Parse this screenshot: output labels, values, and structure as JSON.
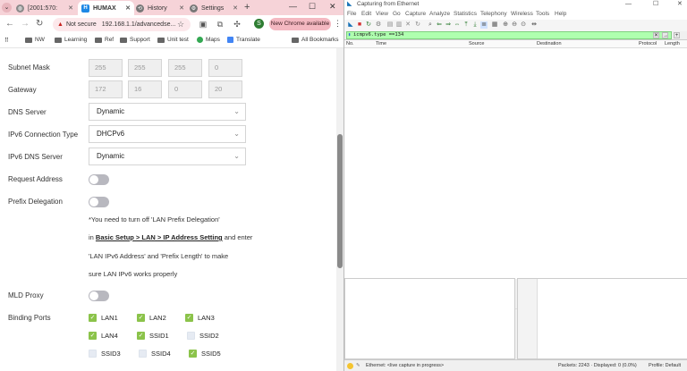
{
  "chrome": {
    "tabs": [
      {
        "label": "[2001:570:",
        "active": false
      },
      {
        "label": "HUMAX",
        "active": true
      },
      {
        "label": "History",
        "active": false
      },
      {
        "label": "Settings",
        "active": false
      }
    ],
    "omnibox": {
      "security": "Not secure",
      "url": "192.168.1.1/advancedse..."
    },
    "profile_initial": "S",
    "new_chrome_label": "New Chrome available",
    "bookmarks": [
      "NW",
      "Learning",
      "Ref",
      "Support",
      "Unit test",
      "Maps",
      "Translate"
    ],
    "all_bookmarks_label": "All Bookmarks"
  },
  "router": {
    "subnet_mask": {
      "label": "Subnet Mask",
      "octets": [
        "255",
        "255",
        "255",
        "0"
      ]
    },
    "gateway": {
      "label": "Gateway",
      "octets": [
        "172",
        "16",
        "0",
        "20"
      ]
    },
    "dns_server": {
      "label": "DNS Server",
      "value": "Dynamic"
    },
    "ipv6_connection_type": {
      "label": "IPv6 Connection Type",
      "value": "DHCPv6"
    },
    "ipv6_dns_server": {
      "label": "IPv6 DNS Server",
      "value": "Dynamic"
    },
    "request_address": {
      "label": "Request Address",
      "enabled": false
    },
    "prefix_delegation": {
      "label": "Prefix Delegation",
      "enabled": false
    },
    "note": {
      "line1": "*You need to turn off 'LAN Prefix Delegation'",
      "line2_prefix": "in ",
      "line2_link": "Basic Setup > LAN > IP Address Setting",
      "line2_suffix": " and enter",
      "line3": "'LAN IPv6 Address' and 'Prefix Length' to make",
      "line4": "sure LAN IPv6 works properly"
    },
    "mld_proxy": {
      "label": "MLD Proxy",
      "enabled": false
    },
    "binding_ports": {
      "label": "Binding Ports",
      "ports": [
        {
          "name": "LAN1",
          "checked": true
        },
        {
          "name": "LAN2",
          "checked": true
        },
        {
          "name": "LAN3",
          "checked": true
        },
        {
          "name": "LAN4",
          "checked": true
        },
        {
          "name": "SSID1",
          "checked": true
        },
        {
          "name": "SSID2",
          "checked": false
        },
        {
          "name": "SSID3",
          "checked": false
        },
        {
          "name": "SSID4",
          "checked": false
        },
        {
          "name": "SSID5",
          "checked": true
        }
      ]
    }
  },
  "wireshark": {
    "title": "Capturing from Ethernet",
    "menu": [
      "File",
      "Edit",
      "View",
      "Go",
      "Capture",
      "Analyze",
      "Statistics",
      "Telephony",
      "Wireless",
      "Tools",
      "Help"
    ],
    "filter": "icmpv6.type ==134",
    "columns": [
      "No.",
      "Time",
      "Source",
      "Destination",
      "Protocol",
      "Length"
    ],
    "status": {
      "interface": "Ethernet: <live capture in progress>",
      "packets": "Packets: 2243 · Displayed: 0 (0.0%)",
      "profile": "Profile: Default"
    }
  },
  "colors": {
    "tabstrip": "#f6d3d8",
    "checkbox_on": "#8bc34a",
    "checkbox_off": "#e6ebf3",
    "filter_bg": "#afffaf"
  }
}
